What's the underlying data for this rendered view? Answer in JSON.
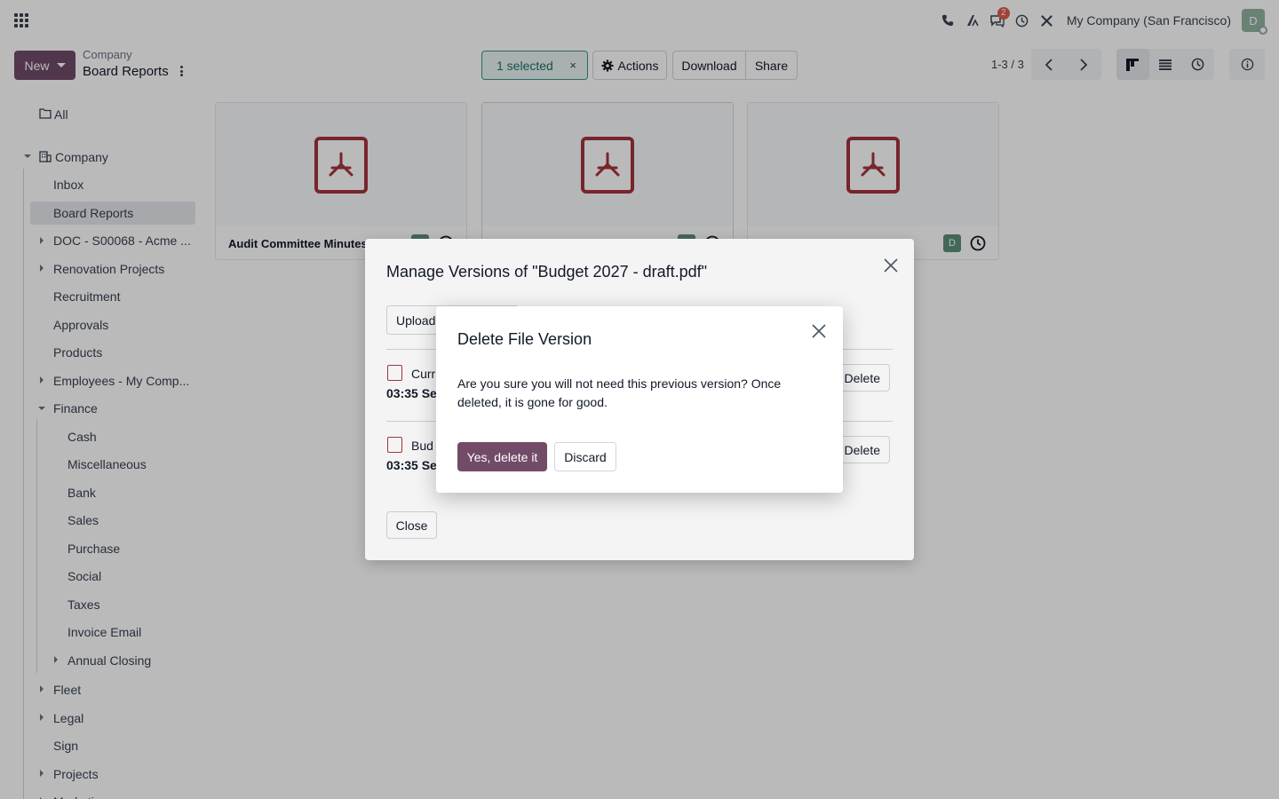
{
  "navbar": {
    "apps_icon": "apps-grid-icon",
    "messages_badge": "2",
    "company": "My Company (San Francisco)",
    "avatar_letter": "D"
  },
  "control_panel": {
    "new_label": "New",
    "breadcrumb_parent": "Company",
    "breadcrumb_current": "Board Reports",
    "selected_label": "1 selected",
    "selected_clear": "×",
    "actions_label": "Actions",
    "download_label": "Download",
    "share_label": "Share",
    "pager_value": "1-3 / 3"
  },
  "sidebar": {
    "all": "All",
    "company": "Company",
    "items": {
      "inbox": "Inbox",
      "board_reports": "Board Reports",
      "doc": "DOC - S00068 - Acme ...",
      "renovation": "Renovation Projects",
      "recruitment": "Recruitment",
      "approvals": "Approvals",
      "products": "Products",
      "employees": "Employees - My Comp...",
      "finance": "Finance",
      "cash": "Cash",
      "misc": "Miscellaneous",
      "bank": "Bank",
      "sales": "Sales",
      "purchase": "Purchase",
      "social": "Social",
      "taxes": "Taxes",
      "invoice_email": "Invoice Email",
      "annual_closing": "Annual Closing",
      "fleet": "Fleet",
      "legal": "Legal",
      "sign": "Sign",
      "projects": "Projects",
      "marketing": "Marketing"
    }
  },
  "cards": [
    {
      "name": "Audit Committee Minutes",
      "avatar": ""
    },
    {
      "name": "",
      "avatar": ""
    },
    {
      "name": "",
      "avatar": "D"
    }
  ],
  "manage_versions": {
    "title": "Manage Versions of \"Budget 2027 - draft.pdf\"",
    "upload_label": "Upload",
    "rows": [
      {
        "name": "Curr",
        "time": "03:35 Se",
        "delete": "Delete"
      },
      {
        "name": "Bud",
        "time": "03:35 Se",
        "delete": "Delete"
      }
    ],
    "close_label": "Close"
  },
  "confirm": {
    "title": "Delete File Version",
    "body": "Are you sure you will not need this previous version? Once deleted, it is gone for good.",
    "yes_label": "Yes, delete it",
    "discard_label": "Discard"
  },
  "colors": {
    "primary": "#714b67",
    "pdf_red": "#a3333d",
    "selected_teal": "#3f8f8a"
  }
}
